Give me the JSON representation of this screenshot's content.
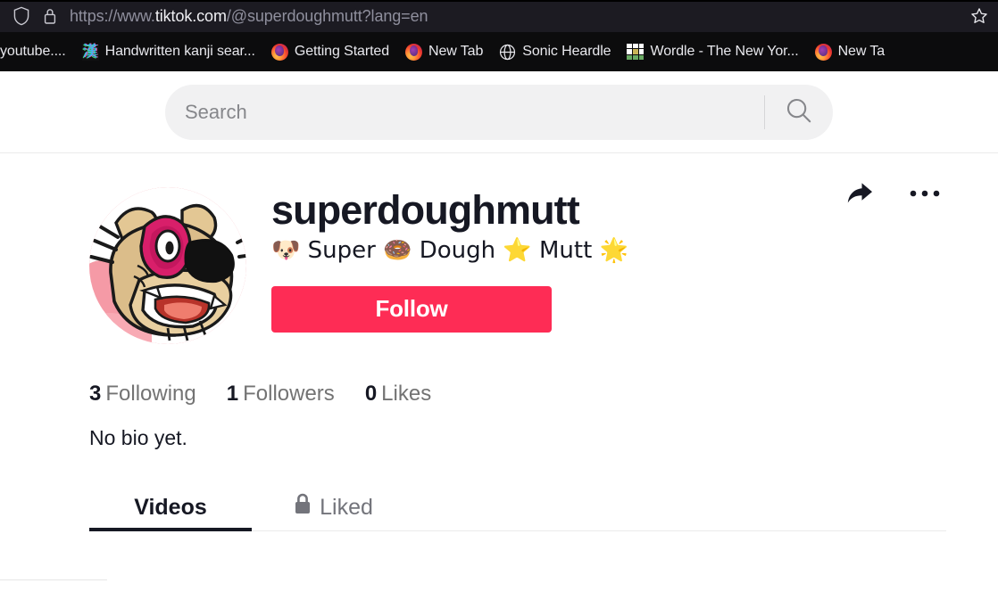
{
  "browser": {
    "url_prefix": "https://www.",
    "url_host": "tiktok.com",
    "url_suffix": "/@superdoughmutt?lang=en",
    "shield_icon": "shield-icon",
    "lock_icon": "lock-icon",
    "star_icon": "star-icon",
    "bookmarks": [
      {
        "label": "youtube....",
        "icon": "none"
      },
      {
        "label": "Handwritten kanji sear...",
        "icon": "kanji-favicon",
        "glyph": "漢"
      },
      {
        "label": "Getting Started",
        "icon": "firefox-favicon"
      },
      {
        "label": "New Tab",
        "icon": "firefox-favicon"
      },
      {
        "label": "Sonic Heardle",
        "icon": "globe-favicon"
      },
      {
        "label": "Wordle - The New Yor...",
        "icon": "wordle-favicon"
      },
      {
        "label": "New Ta",
        "icon": "firefox-favicon"
      }
    ]
  },
  "search": {
    "value": "",
    "placeholder": "Search",
    "icon": "search-icon"
  },
  "profile": {
    "avatar_alt": "cartoon dog avatar",
    "username": "superdoughmutt",
    "display_name": "🐶 Super 🍩 Dough ⭐ Mutt 🌟",
    "follow_label": "Follow",
    "follow_color": "#fe2c55",
    "share_icon": "share-arrow-icon",
    "more_icon": "more-options-icon",
    "stats": [
      {
        "num": "3",
        "label": "Following"
      },
      {
        "num": "1",
        "label": "Followers"
      },
      {
        "num": "0",
        "label": "Likes"
      }
    ],
    "bio": "No bio yet."
  },
  "tabs": [
    {
      "label": "Videos",
      "active": true,
      "icon": "none"
    },
    {
      "label": "Liked",
      "active": false,
      "icon": "lock-icon"
    }
  ]
}
